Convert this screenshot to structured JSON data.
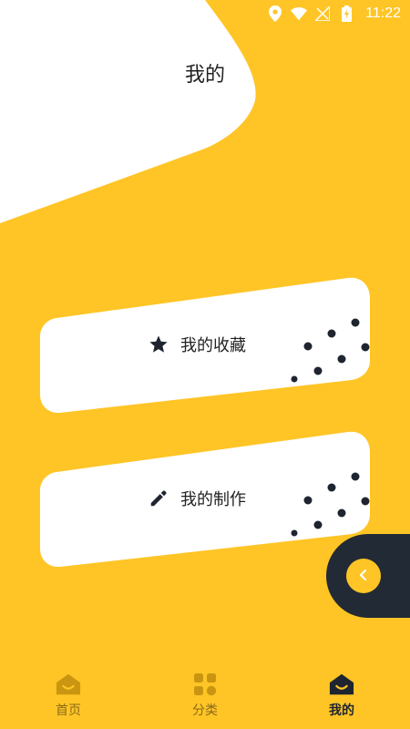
{
  "status_bar": {
    "time": "11:22"
  },
  "header": {
    "title": "我的"
  },
  "cards": [
    {
      "label": "我的收藏",
      "icon": "star-icon"
    },
    {
      "label": "我的制作",
      "icon": "pencil-icon"
    }
  ],
  "float_button": {
    "icon": "chevron-left-icon"
  },
  "tabbar": {
    "items": [
      {
        "label": "首页",
        "icon": "home-icon",
        "active": false
      },
      {
        "label": "分类",
        "icon": "grid-icon",
        "active": false
      },
      {
        "label": "我的",
        "icon": "profile-house-icon",
        "active": true
      }
    ]
  },
  "colors": {
    "background": "#FFC526",
    "card": "#FFFFFF",
    "dark": "#222A35",
    "accent": "#FFC526"
  }
}
